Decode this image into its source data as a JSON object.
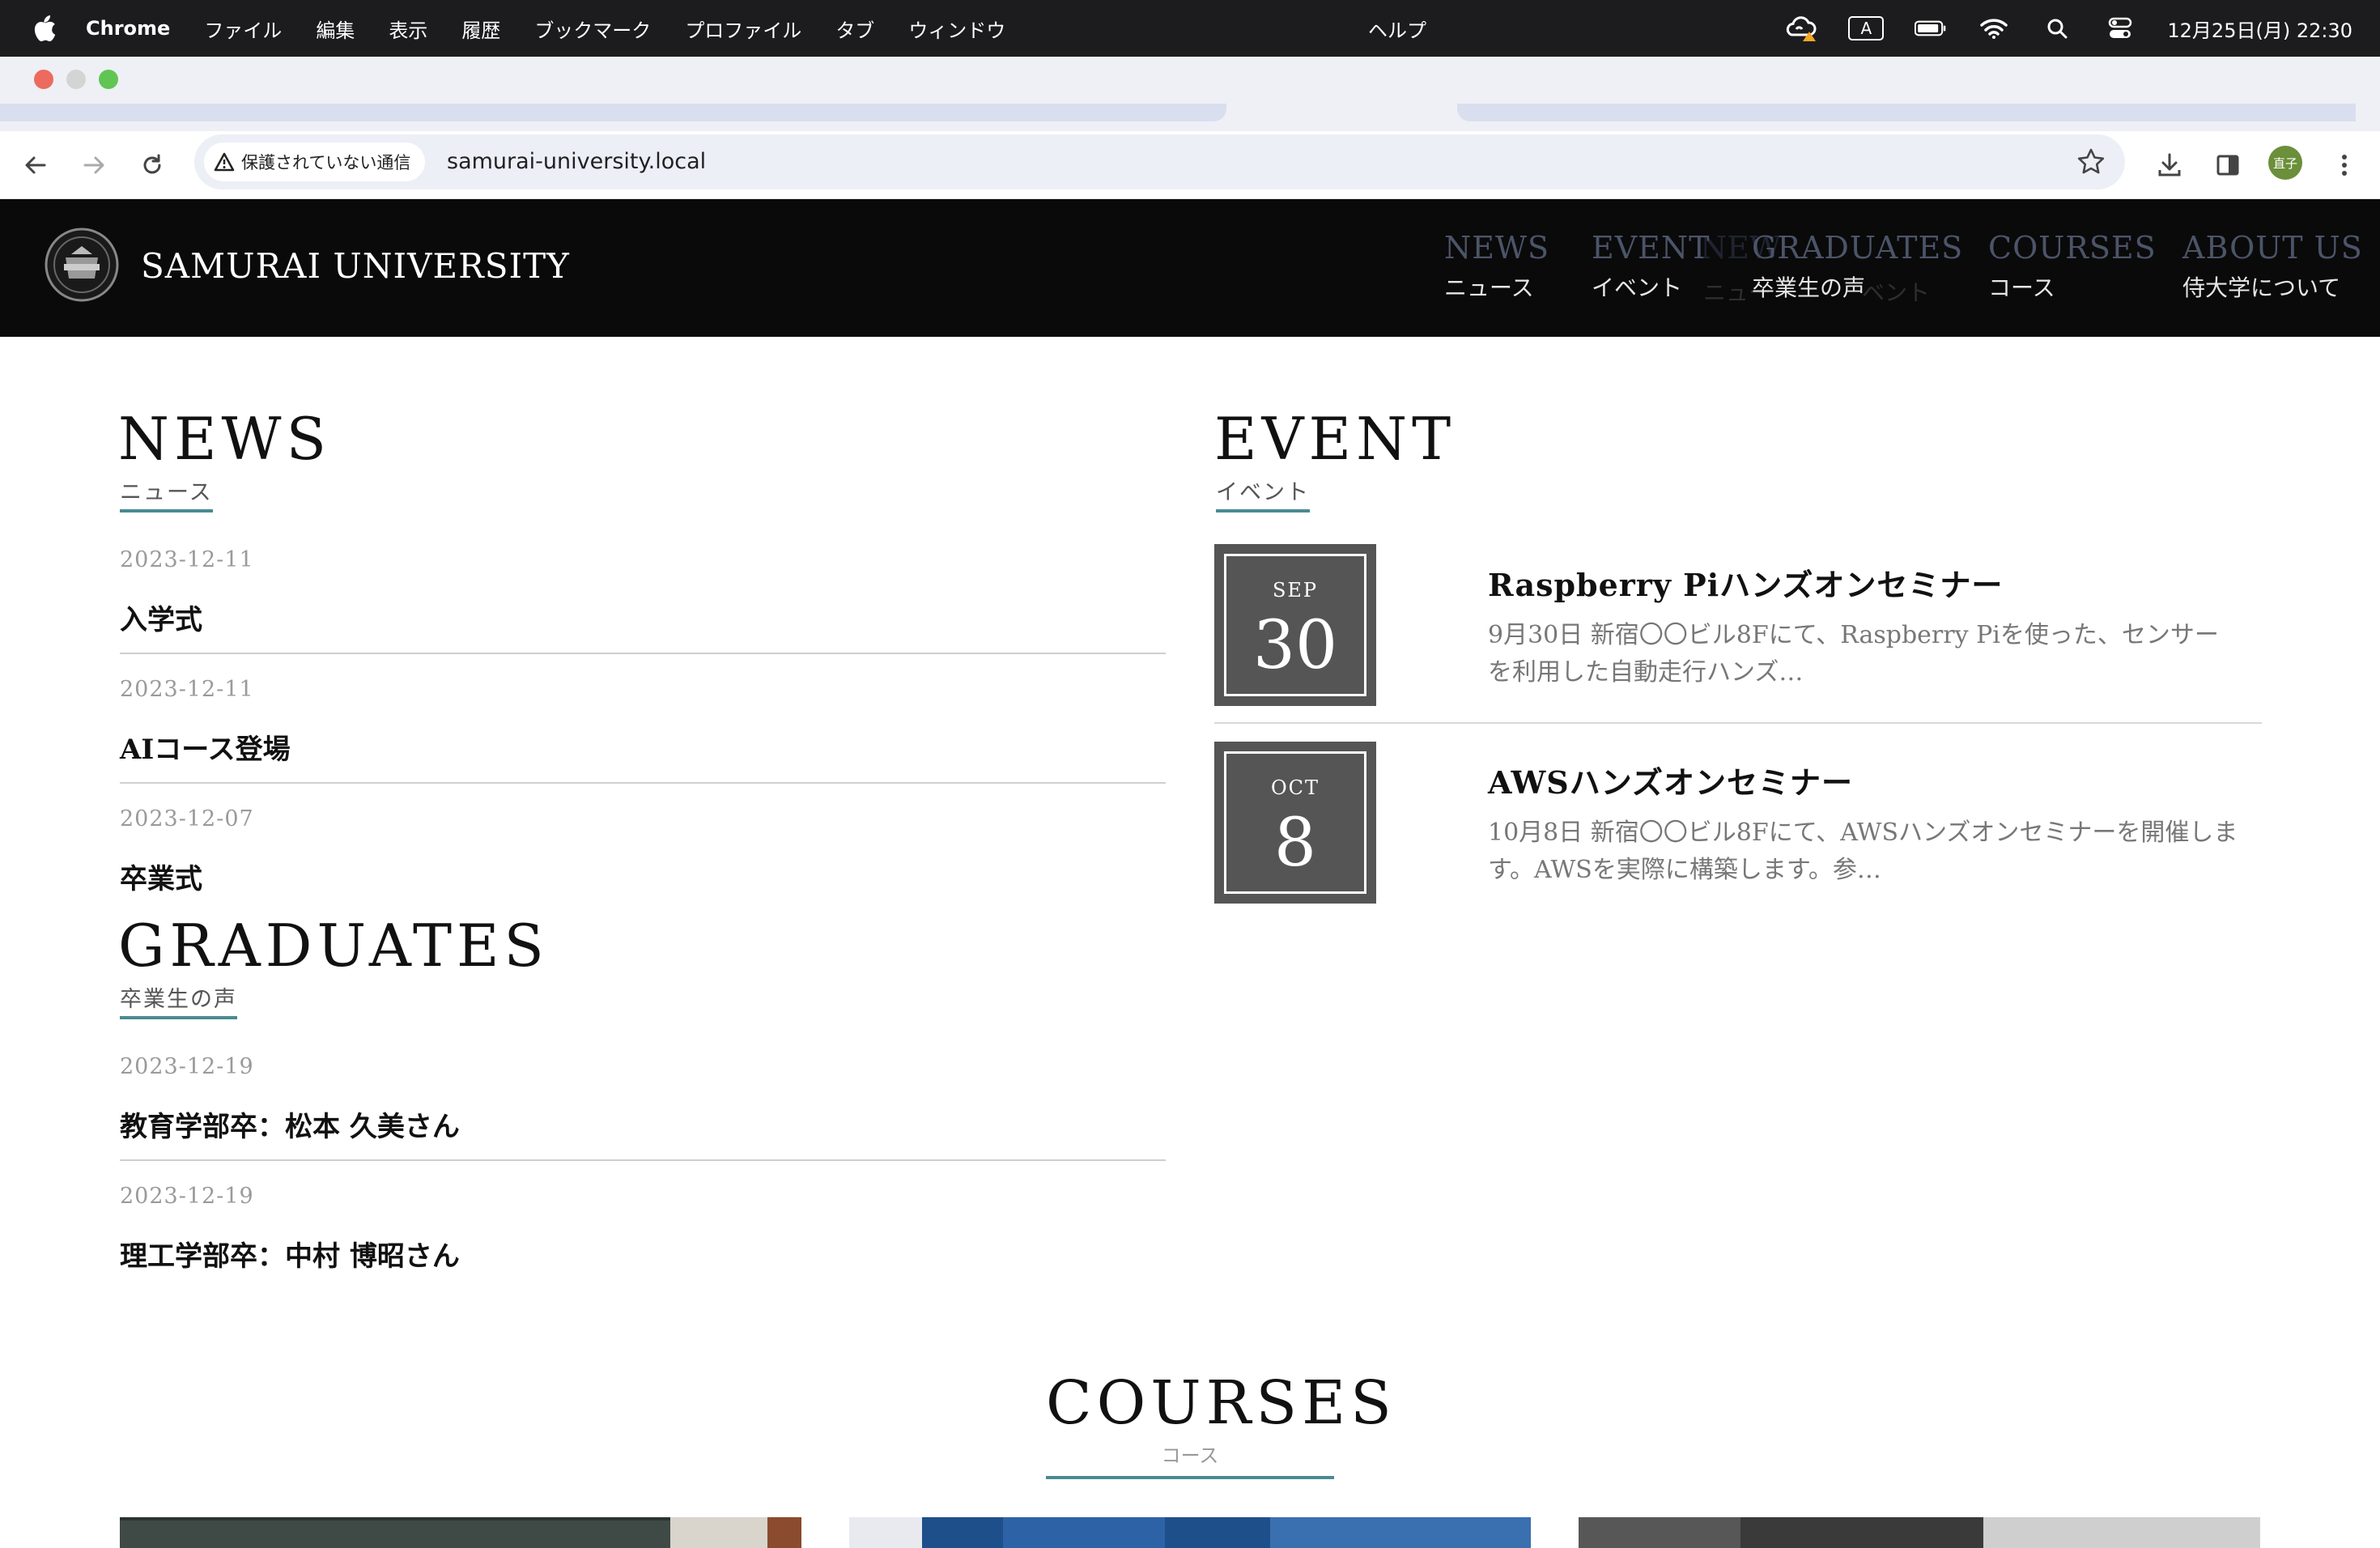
{
  "menubar": {
    "app_name": "Chrome",
    "items": [
      "ファイル",
      "編集",
      "表示",
      "履歴",
      "ブックマーク",
      "プロファイル",
      "タブ",
      "ウィンドウ"
    ],
    "help": "ヘルプ",
    "ime_indicator": "A",
    "datetime": "12月25日(月) 22:30"
  },
  "browser": {
    "security_label": "保護されていない通信",
    "url": "samurai-university.local",
    "profile_initials": "直子"
  },
  "site": {
    "brand": "SAMURAI UNIVERSITY",
    "nav": [
      {
        "en": "NEWS",
        "ja": "ニュース"
      },
      {
        "en": "EVENT",
        "ja": "イベント"
      },
      {
        "en": "GRADUATES",
        "ja": "卒業生の声"
      },
      {
        "en": "COURSES",
        "ja": "コース"
      },
      {
        "en": "ABOUT US",
        "ja": "侍大学について"
      }
    ]
  },
  "news": {
    "title": "NEWS",
    "subtitle": "ニュース",
    "posts": [
      {
        "date": "2023-12-11",
        "title": "入学式"
      },
      {
        "date": "2023-12-11",
        "title": "AIコース登場"
      },
      {
        "date": "2023-12-07",
        "title": "卒業式"
      }
    ]
  },
  "graduates": {
    "title": "GRADUATES",
    "subtitle": "卒業生の声",
    "posts": [
      {
        "date": "2023-12-19",
        "title": "教育学部卒：松本 久美さん"
      },
      {
        "date": "2023-12-19",
        "title": "理工学部卒：中村 博昭さん"
      }
    ]
  },
  "event": {
    "title": "EVENT",
    "subtitle": "イベント",
    "items": [
      {
        "month": "SEP",
        "day": "30",
        "title": "Raspberry Piハンズオンセミナー",
        "desc": "9月30日 新宿〇〇ビル8Fにて、Raspberry Piを使った、センサーを利用した自動走行ハンズ…"
      },
      {
        "month": "OCT",
        "day": "8",
        "title": "AWSハンズオンセミナー",
        "desc": "10月8日 新宿〇〇ビル8Fにて、AWSハンズオンセミナーを開催します。AWSを実際に構築します。参…"
      }
    ]
  },
  "courses": {
    "title": "COURSES",
    "subtitle": "コース"
  },
  "colors": {
    "accent": "#4a8a92",
    "header_bg": "#0a0a0a",
    "date_box": "#555555"
  }
}
